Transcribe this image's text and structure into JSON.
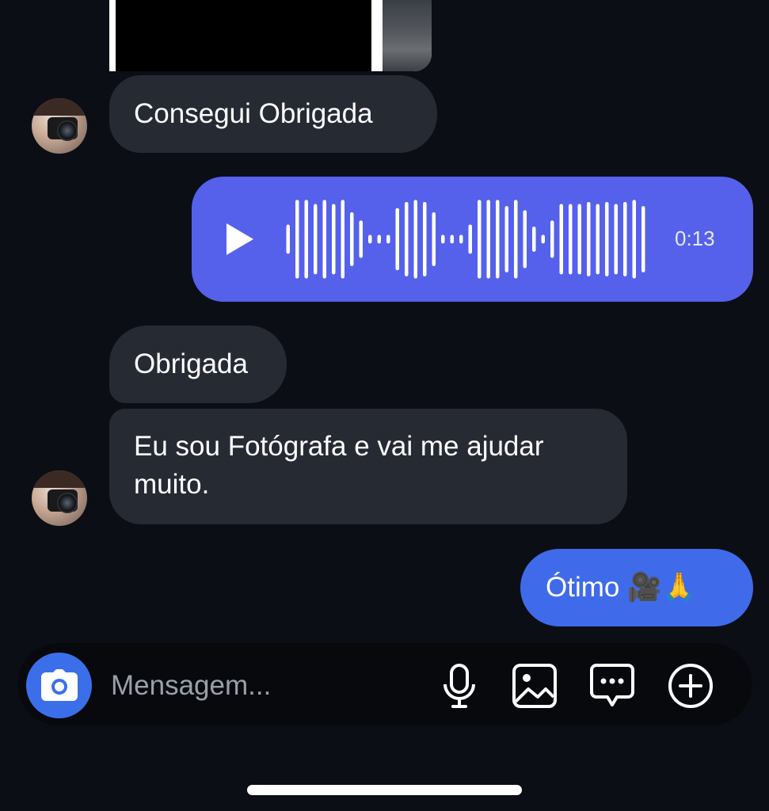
{
  "messages": {
    "first_text": "Consegui  Obrigada",
    "voice_duration": "0:13",
    "second_text": "Obrigada",
    "third_text": "Eu sou Fotógrafa e vai me ajudar muito.",
    "sent_text": "Ótimo 🎥🙏"
  },
  "composer": {
    "placeholder": "Mensagem..."
  },
  "icons": {
    "camera": "camera-icon",
    "mic": "microphone-icon",
    "gallery": "image-icon",
    "sticker": "chat-bubble-icon",
    "plus": "plus-circle-icon",
    "play": "play-icon"
  },
  "colors": {
    "background": "#0b0e14",
    "incoming_bubble": "#262a33",
    "voice_bubble": "#5561ea",
    "outgoing_bubble": "#3f6bea",
    "accent": "#3b6fea"
  },
  "voice_waveform": [
    0.35,
    0.95,
    0.95,
    0.85,
    0.95,
    0.85,
    0.95,
    0.65,
    0.45,
    0.1,
    0.1,
    0.1,
    0.75,
    0.9,
    0.95,
    0.9,
    0.65,
    0.1,
    0.1,
    0.1,
    0.35,
    0.95,
    0.95,
    0.95,
    0.8,
    0.95,
    0.7,
    0.3,
    0.1,
    0.45,
    0.85,
    0.85,
    0.85,
    0.9,
    0.85,
    0.9,
    0.85,
    0.9,
    0.95,
    0.8
  ]
}
